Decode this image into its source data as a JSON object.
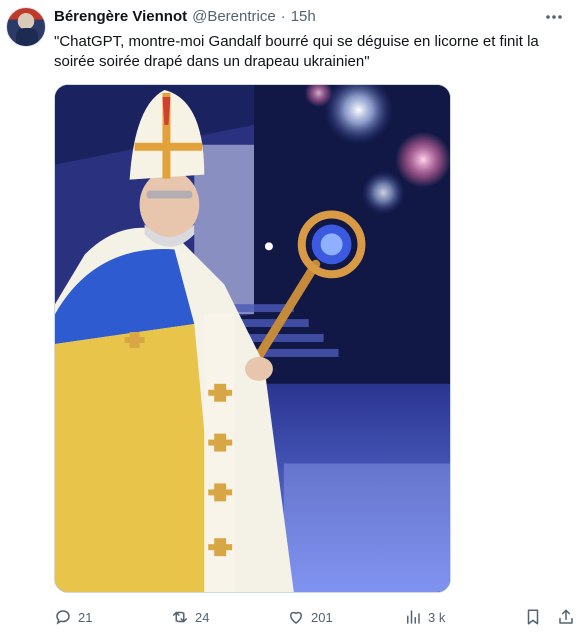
{
  "tweet": {
    "author": {
      "name": "Bérengère Viennot",
      "handle": "@Berentrice",
      "separator": "·",
      "time": "15h",
      "avatar_icon": "user-avatar"
    },
    "text": "\"ChatGPT, montre-moi Gandalf bourré qui se déguise en licorne et finit la soirée soirée drapé dans un drapeau ukrainien\"",
    "media": {
      "type": "image",
      "icon": "photo"
    },
    "actions": {
      "reply": {
        "icon": "reply-icon",
        "count": "21"
      },
      "retweet": {
        "icon": "retweet-icon",
        "count": "24"
      },
      "like": {
        "icon": "heart-icon",
        "count": "201"
      },
      "views": {
        "icon": "views-chart-icon",
        "count": "3 k"
      },
      "bookmark": {
        "icon": "bookmark-icon"
      },
      "share": {
        "icon": "share-icon"
      }
    }
  },
  "colors": {
    "text_primary": "#0f1419",
    "text_secondary": "#536471",
    "border": "#cfd9de",
    "flag_blue": "#2f5bd0",
    "flag_yellow": "#e8c54a"
  }
}
